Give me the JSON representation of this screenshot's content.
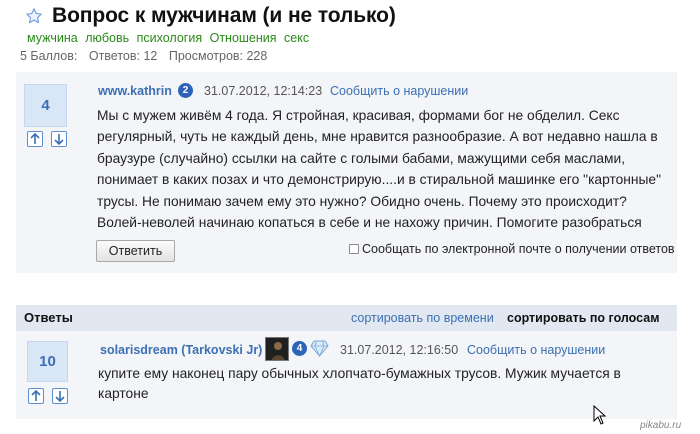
{
  "question": {
    "title": "Вопрос к мужчинам (и не только)",
    "tags": [
      "мужчина",
      "любовь",
      "психология",
      "Отношения",
      "секс"
    ],
    "stats": {
      "points": "5 Баллов:",
      "answers": "Ответов: 12",
      "views": "Просмотров: 228"
    },
    "score": "4",
    "author": "www.kathrin",
    "author_level": "2",
    "date": "31.07.2012, 12:14:23",
    "report_label": "Сообщить о нарушении",
    "body": "Мы с мужем живём 4 года. Я стройная, красивая, формами бог не обделил. Секс регулярный, чуть не каждый день, мне нравится разнообразие. А вот недавно нашла в браузуре (случайно) ссылки на сайте с голыми бабами, мажущими себя маслами, понимает в каких позах и что демонстрирую....и в стиральной машинке его \"картонные\" трусы. Не понимаю зачем ему это нужно? Обидно очень. Почему это происходит? Волей-неволей начинаю копаться в себе и не нахожу причин. Помогите разобраться",
    "reply_label": "Ответить",
    "notify_label": "Сообщать по электронной почте о получении ответов"
  },
  "answers_section": {
    "title": "Ответы",
    "sort_by_time": "сортировать по времени",
    "sort_by_votes": "сортировать по голосам"
  },
  "answers": [
    {
      "score": "10",
      "author": "solarisdream (Tarkovski Jr)",
      "author_level": "4",
      "date": "31.07.2012, 12:16:50",
      "report_label": "Сообщить о нарушении",
      "body": "купите ему наконец пару обычных хлопчато-бумажных трусов. Мужик мучается в картоне"
    }
  ],
  "icons": {
    "favorite": "star-icon",
    "vote_up": "arrow-up-icon",
    "vote_down": "arrow-down-icon",
    "level": "level-badge-icon",
    "expert": "diamond-icon",
    "cursor": "cursor-icon"
  },
  "colors": {
    "link": "#3c6fb3",
    "tag": "#2a8a18",
    "panel": "#f3f5f8",
    "answers_bar": "#e1e8f2",
    "score_box": "#d9e6f5",
    "badge": "#2d64b8"
  },
  "watermark": "pikabu.ru"
}
